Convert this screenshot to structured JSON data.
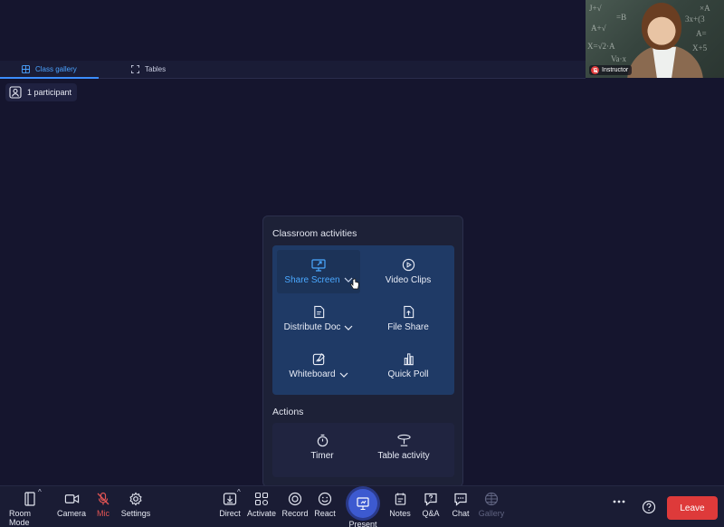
{
  "video_tile": {
    "name": "Instructor",
    "board_formulas": [
      "J+√",
      "A+√",
      "X=√2·A",
      "×A",
      "3x+(3",
      "A=",
      "X+5",
      "=B",
      "Va·x"
    ]
  },
  "tabs": [
    {
      "label": "Class gallery",
      "icon": "grid-icon"
    },
    {
      "label": "Tables",
      "icon": "expand-icon"
    }
  ],
  "participants": {
    "label": "1 participant"
  },
  "panel": {
    "activities_title": "Classroom activities",
    "activities": [
      {
        "label": "Share Screen",
        "icon": "share-screen-icon",
        "has_chevron": true,
        "selected": true
      },
      {
        "label": "Video Clips",
        "icon": "play-icon",
        "has_chevron": false
      },
      {
        "label": "Distribute Doc",
        "icon": "document-icon",
        "has_chevron": true
      },
      {
        "label": "File Share",
        "icon": "file-share-icon",
        "has_chevron": false
      },
      {
        "label": "Whiteboard",
        "icon": "whiteboard-icon",
        "has_chevron": true
      },
      {
        "label": "Quick Poll",
        "icon": "bar-chart-icon",
        "has_chevron": false
      }
    ],
    "actions_title": "Actions",
    "actions": [
      {
        "label": "Timer",
        "icon": "timer-icon"
      },
      {
        "label": "Table activity",
        "icon": "table-icon"
      }
    ]
  },
  "toolbar": {
    "room_mode": "Room Mode",
    "camera": "Camera",
    "mic": "Mic",
    "settings": "Settings",
    "direct": "Direct",
    "activate": "Activate",
    "record": "Record",
    "react": "React",
    "present": "Present",
    "notes": "Notes",
    "qa": "Q&A",
    "chat": "Chat",
    "gallery": "Gallery",
    "leave": "Leave"
  },
  "colors": {
    "background": "#15152e",
    "accent": "#3b8dff",
    "leave": "#de3a3a",
    "muted": "#e25454"
  }
}
